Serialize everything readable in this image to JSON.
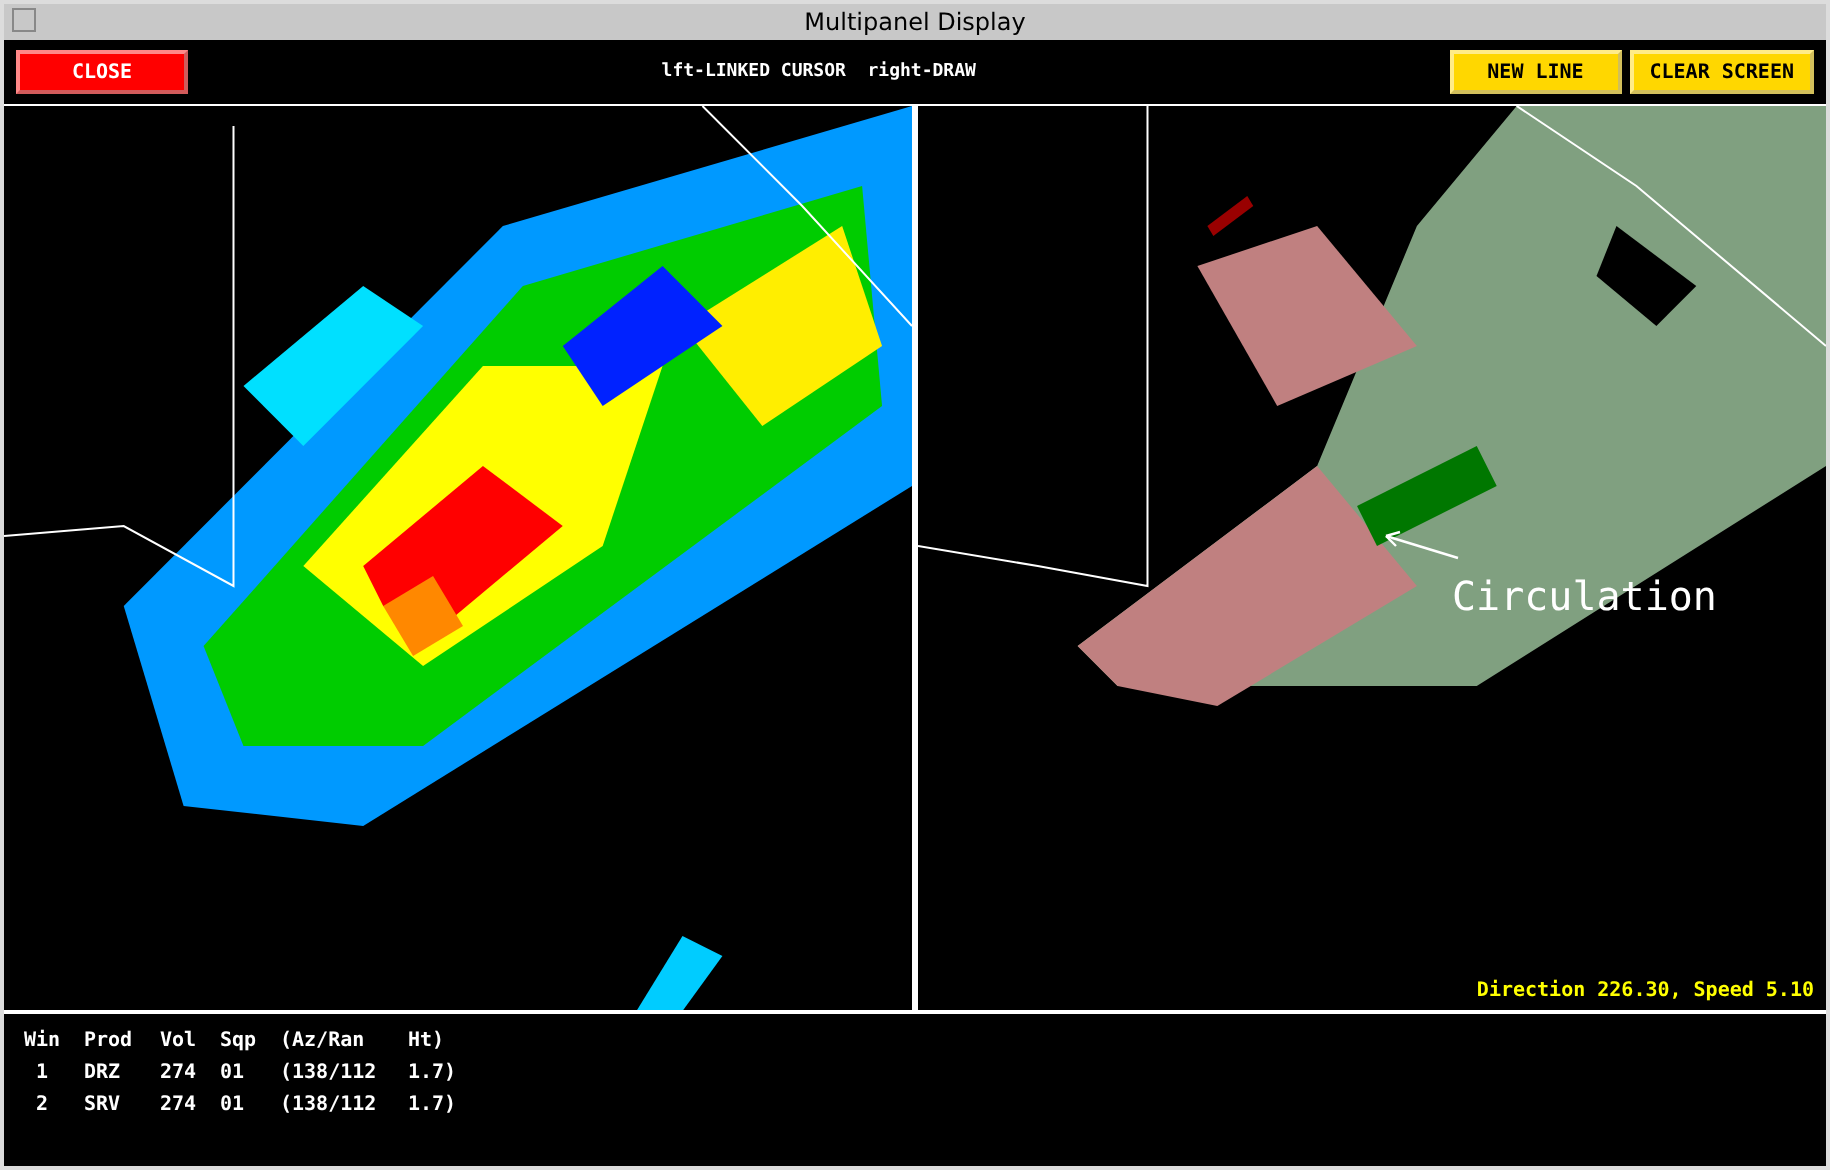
{
  "window": {
    "title": "Multipanel Display"
  },
  "toolbar": {
    "buttons": [
      {
        "label": "CLOSE",
        "color": "#ff0000"
      },
      {
        "label": "NEW LINE",
        "color": "#ffd700"
      },
      {
        "label": "CLEAR SCREEN",
        "color": "#ffd700"
      }
    ],
    "mode_hint": "lft-LINKED CURSOR  right-DRAW"
  },
  "panels": [
    {
      "kind": "reflectivity"
    },
    {
      "kind": "velocity",
      "annotation": "Circulation",
      "status": "Direction 226.30, Speed 5.10"
    }
  ],
  "table": {
    "columns": [
      "Win",
      "Prod",
      "Vol",
      "Sqp",
      "(Az/Ran",
      "Ht)"
    ],
    "rows": [
      [
        "1",
        "DRZ",
        "274",
        "01",
        "(138/112",
        "1.7)"
      ],
      [
        "2",
        "SRV",
        "274",
        "01",
        "(138/112",
        "1.7)"
      ]
    ]
  }
}
